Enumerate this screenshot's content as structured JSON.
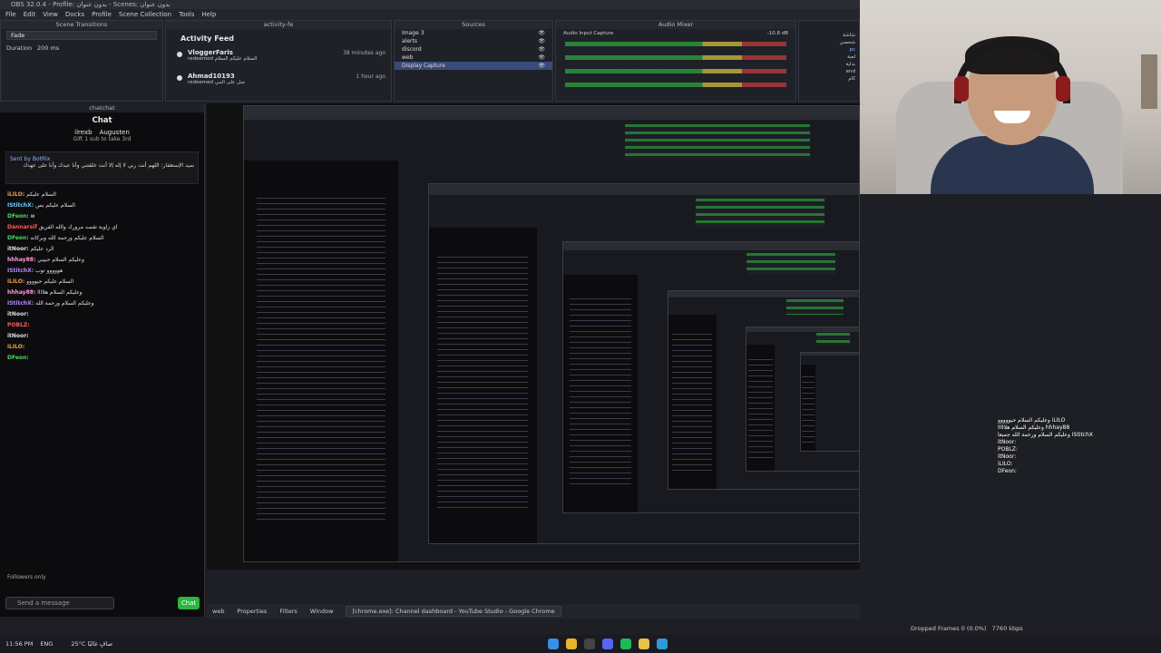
{
  "window": {
    "title": "OBS 32.0.4 - Profile: بدون عنوان - Scenes: بدون عنوان"
  },
  "menu": [
    "File",
    "Edit",
    "View",
    "Docks",
    "Profile",
    "Scene Collection",
    "Tools",
    "Help"
  ],
  "transitions": {
    "title": "Scene Transitions",
    "selected": "Fade",
    "duration_label": "Duration",
    "duration_value": "200 ms"
  },
  "activity_feed": {
    "dock_title": "activity-fe",
    "title": "Activity Feed",
    "items": [
      {
        "name": "VloggerFaris",
        "sub": "redeemed السلام عليكم السلام",
        "ago": "38 minutes ago"
      },
      {
        "name": "Ahmad10193",
        "sub": "redeemed صل على النبي",
        "ago": "1 hour ago"
      }
    ]
  },
  "sources": {
    "title": "Sources",
    "items": [
      {
        "label": "Image 3"
      },
      {
        "label": "alerts"
      },
      {
        "label": "discord"
      },
      {
        "label": "web"
      },
      {
        "label": "Display Capture"
      }
    ]
  },
  "mixer": {
    "title": "Audio Mixer",
    "channel": "Audio Input Capture",
    "db": "-10.8 dB"
  },
  "scenes": [
    "شاشة",
    "شخصي",
    "pc",
    "لعبة",
    "بداية",
    "end",
    "كام"
  ],
  "chat": {
    "dock_title": "chatchat",
    "title": "Chat",
    "gifter_user": "ilrexb",
    "gifter_user2": "Augusten",
    "gifter_sub": "Gift 1 sub to take 3rd",
    "pinned_by": "Sent by BotRix",
    "pinned_text": "سيد الإستغفار: اللهم أنت ربي لا إله إلا أنت خلقتني وأنا عبدك وأنا على عهدك",
    "messages": [
      {
        "user": "iLILO:",
        "text": "السلام عليكم"
      },
      {
        "user": "IStitchX:",
        "text": "السلام عليكم بس"
      },
      {
        "user": "DFeon:",
        "text": "w"
      },
      {
        "user": "Dannarsif",
        "text": "اي زاوية تقصد مرورك والله الفريق"
      },
      {
        "user": "DFeon:",
        "text": "السلام عليكم ورحمة الله وبركاته"
      },
      {
        "user": "itNoor:",
        "text": "الرد عليكم"
      },
      {
        "user": "hhhay88:",
        "text": "وعليكم السلام حبيبي"
      },
      {
        "user": "IStitchX:",
        "text": "هووووو توب"
      },
      {
        "user": "iLILO:",
        "text": "السلام عليكم حيوووو"
      },
      {
        "user": "hhhay88:",
        "text": "وعليكم السلام هلاااا"
      },
      {
        "user": "IStitchX:",
        "text": "وعليكم السلام ورحمة الله"
      },
      {
        "user": "itNoor:",
        "text": ""
      },
      {
        "user": "POBLZ:",
        "text": ""
      },
      {
        "user": "itNoor:",
        "text": ""
      },
      {
        "user": "iLILO:",
        "text": ""
      },
      {
        "user": "DFeon:",
        "text": ""
      }
    ],
    "followers_label": "Followers only",
    "input_placeholder": "Send a message",
    "send_button": "Chat"
  },
  "obs_status": {
    "properties": "Properties",
    "filters": "Filters",
    "window_label": "Window",
    "window_value": "[chrome.exe]: Channel dashboard - YouTube Studio - Google Chrome",
    "web": "web"
  },
  "stats": {
    "dropped": "Dropped Frames 0 (0.0%)",
    "kbps": "7760 kbps"
  },
  "taskbar": {
    "lang": "ENG",
    "weather": "25°C صافٍ غالبًا",
    "time": "11:56 PM"
  },
  "echo_lines": [
    "وعليكم السلام حيووووو iLILO",
    "وعليكم السلام هلااااا hhhay88",
    "وعليكم السلام ورحمة الله جميعا IStitchX",
    "itNoor:",
    "POBLZ:",
    "itNoor:",
    "iLILO:",
    "DFeon:"
  ]
}
